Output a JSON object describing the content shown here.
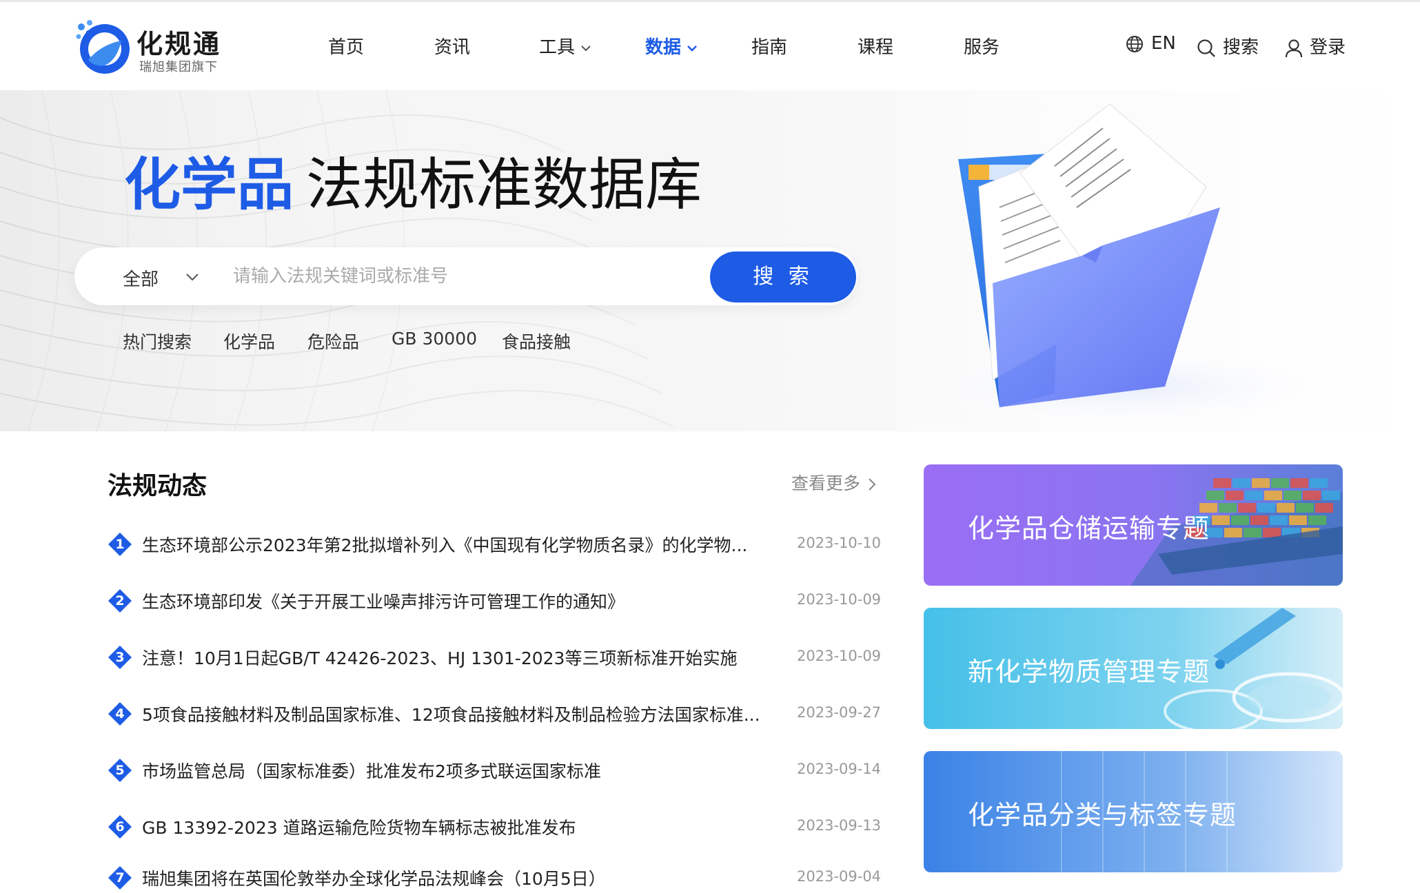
{
  "brand": {
    "name": "化规通",
    "subtitle": "瑞旭集团旗下"
  },
  "nav": {
    "items": [
      {
        "label": "首页"
      },
      {
        "label": "资讯"
      },
      {
        "label": "工具"
      },
      {
        "label": "数据"
      },
      {
        "label": "指南"
      },
      {
        "label": "课程"
      },
      {
        "label": "服务"
      }
    ],
    "active": "数据",
    "lang": "EN",
    "search": "搜索",
    "login": "登录"
  },
  "hero": {
    "title_highlight": "化学品",
    "title_rest": "法规标准数据库",
    "search": {
      "scope": "全部",
      "placeholder": "请输入法规关键词或标准号",
      "button": "搜 索"
    },
    "hot_label": "热门搜索",
    "hot_terms": [
      "化学品",
      "危险品",
      "GB 30000",
      "食品接触"
    ]
  },
  "news": {
    "title": "法规动态",
    "more": "查看更多",
    "items": [
      {
        "num": "1",
        "title": "生态环境部公示2023年第2批拟增补列入《中国现有化学物质名录》的化学物...",
        "date": "2023-10-10"
      },
      {
        "num": "2",
        "title": "生态环境部印发《关于开展工业噪声排污许可管理工作的通知》",
        "date": "2023-10-09"
      },
      {
        "num": "3",
        "title": "注意！10月1日起GB/T 42426-2023、HJ 1301-2023等三项新标准开始实施",
        "date": "2023-10-09"
      },
      {
        "num": "4",
        "title": "5项食品接触材料及制品国家标准、12项食品接触材料及制品检验方法国家标准...",
        "date": "2023-09-27"
      },
      {
        "num": "5",
        "title": "市场监管总局（国家标准委）批准发布2项多式联运国家标准",
        "date": "2023-09-14"
      },
      {
        "num": "6",
        "title": "GB 13392-2023 道路运输危险货物车辆标志被批准发布",
        "date": "2023-09-13"
      },
      {
        "num": "7",
        "title": "瑞旭集团将在英国伦敦举办全球化学品法规峰会（10月5日）",
        "date": "2023-09-04"
      }
    ]
  },
  "topics": [
    {
      "label": "化学品仓储运输专题"
    },
    {
      "label": "新化学物质管理专题"
    },
    {
      "label": "化学品分类与标签专题"
    }
  ],
  "colors": {
    "accent": "#1e5ce6",
    "topic1": "#8f6cf0",
    "topic2": "#48c4e8",
    "topic3": "#3a86e8"
  },
  "icons": [
    "logo-mark-icon",
    "chevron-down-icon",
    "globe-icon",
    "search-icon",
    "user-icon",
    "chevron-right-icon",
    "number-badge-icon"
  ]
}
